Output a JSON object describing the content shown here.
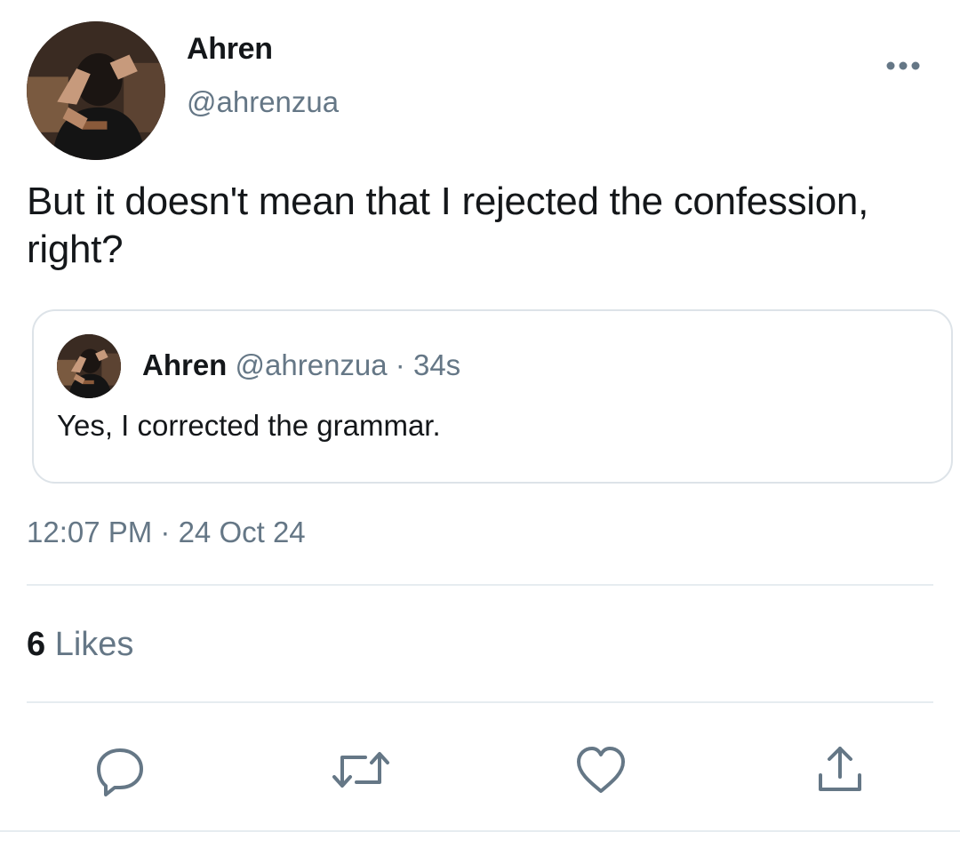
{
  "author": {
    "display_name": "Ahren",
    "handle": "@ahrenzua",
    "avatar_icon": "profile-photo"
  },
  "tweet": {
    "text": "But it doesn't mean that I rejected the confession, right?",
    "timestamp": "12:07 PM · 24 Oct 24"
  },
  "quoted_tweet": {
    "display_name": "Ahren",
    "handle": "@ahrenzua",
    "separator": "·",
    "time": "34s",
    "text": "Yes, I corrected the grammar."
  },
  "stats": {
    "likes_count": "6",
    "likes_label": "Likes"
  },
  "actions": [
    "reply-icon",
    "retweet-icon",
    "like-icon",
    "share-icon"
  ],
  "colors": {
    "text_primary": "#14171a",
    "text_secondary": "#657786",
    "divider": "#e6ecf0",
    "icon": "#657786"
  }
}
